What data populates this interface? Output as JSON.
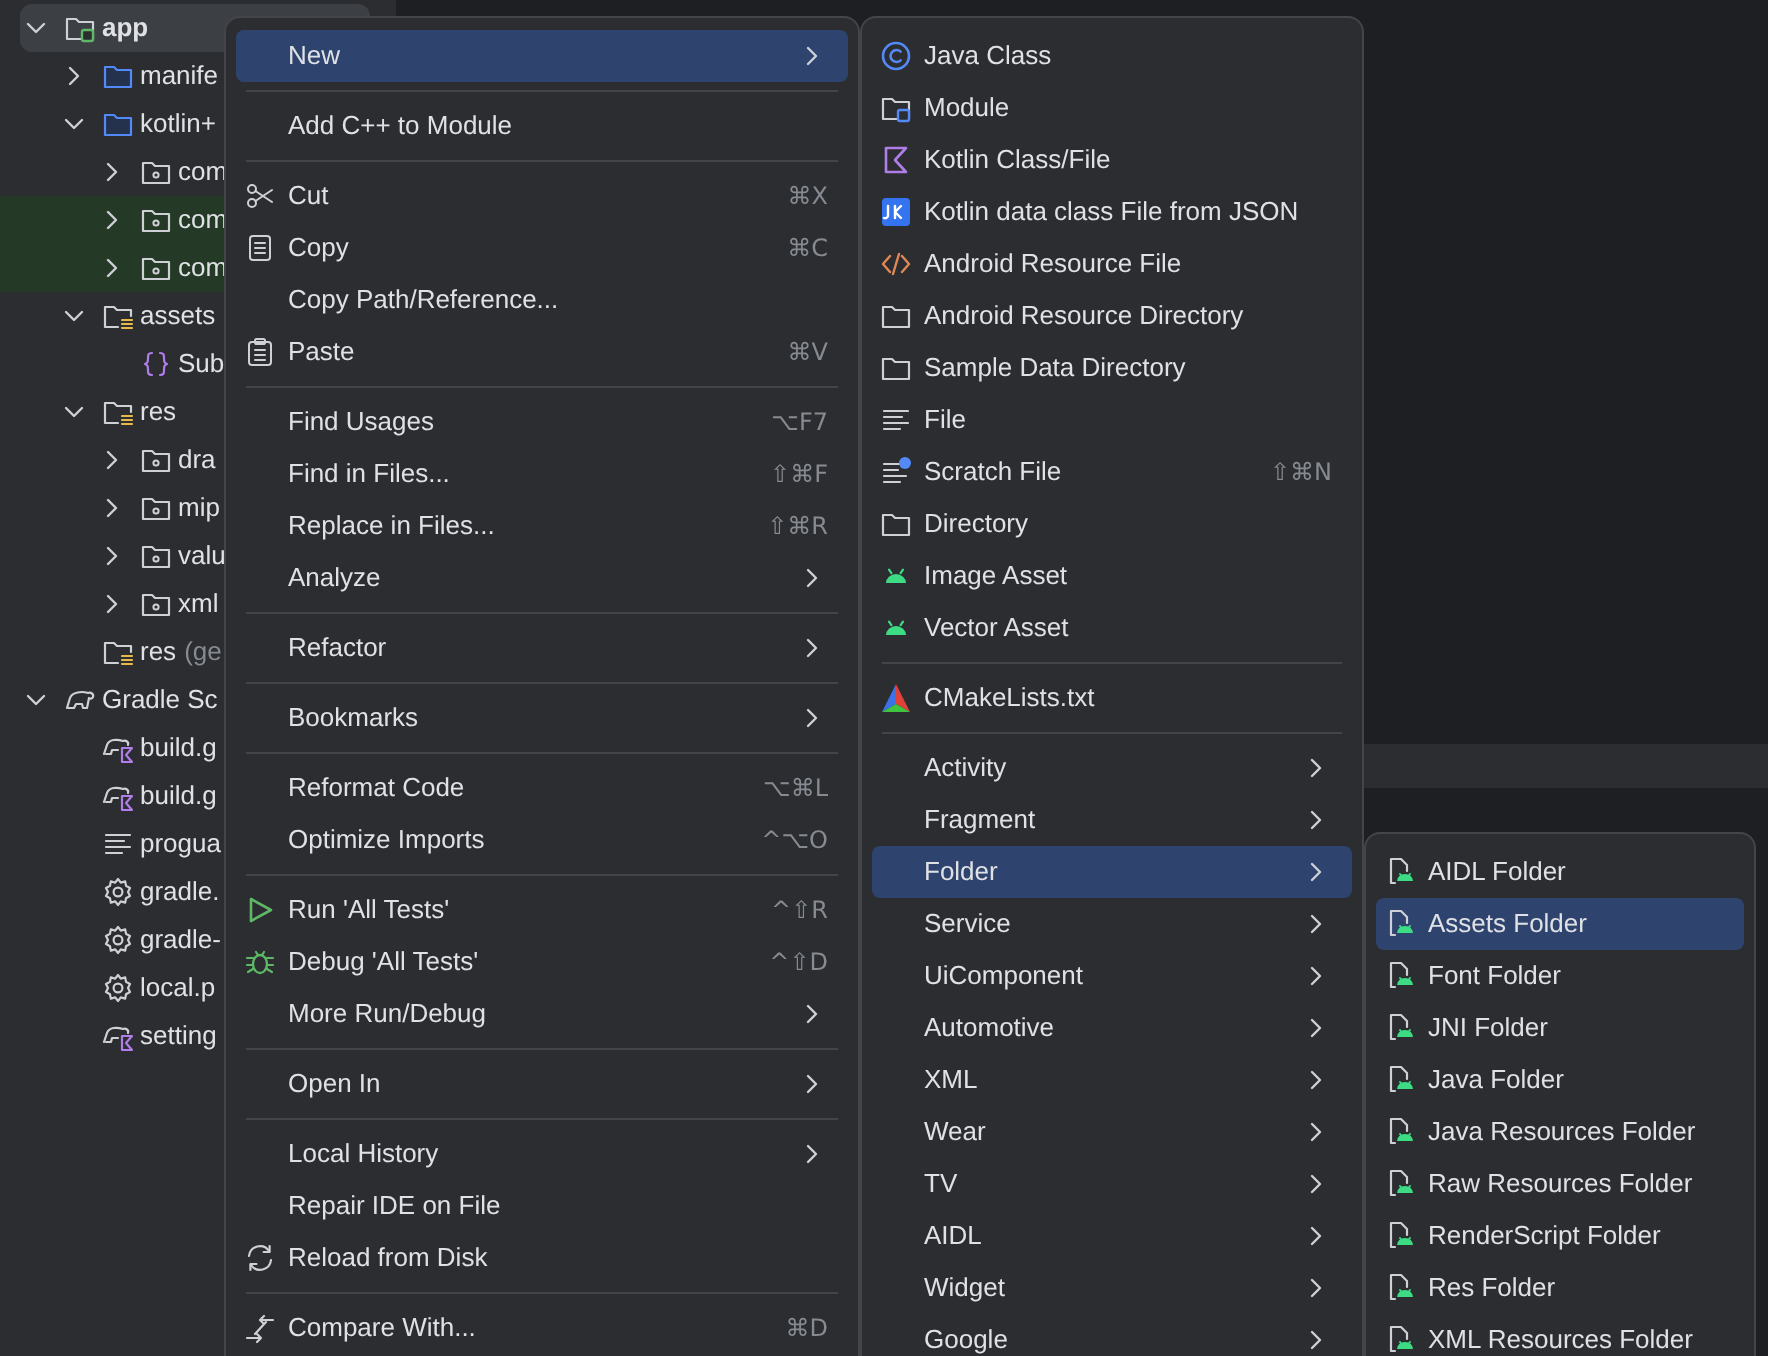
{
  "project_tree": [
    {
      "label": "app",
      "kind": "module",
      "expanded": true,
      "selected": true,
      "highlighted": false,
      "children": [
        {
          "label": "manife",
          "kind": "source-folder",
          "expanded": false,
          "selected": false,
          "highlighted": false
        },
        {
          "label": "kotlin+",
          "kind": "source-folder",
          "expanded": true,
          "selected": false,
          "highlighted": false,
          "children": [
            {
              "label": "com",
              "kind": "package",
              "expanded": false,
              "selected": false,
              "highlighted": false
            },
            {
              "label": "com",
              "kind": "package",
              "expanded": false,
              "selected": false,
              "highlighted": true
            },
            {
              "label": "com",
              "kind": "package",
              "expanded": false,
              "selected": false,
              "highlighted": true
            }
          ]
        },
        {
          "label": "assets",
          "kind": "resource-folder",
          "expanded": true,
          "selected": false,
          "highlighted": false,
          "children": [
            {
              "label": "Sub",
              "kind": "json-file",
              "selected": false,
              "highlighted": false
            }
          ]
        },
        {
          "label": "res",
          "kind": "resource-folder",
          "expanded": true,
          "selected": false,
          "highlighted": false,
          "children": [
            {
              "label": "dra",
              "kind": "package",
              "expanded": false,
              "selected": false,
              "highlighted": false
            },
            {
              "label": "mip",
              "kind": "package",
              "expanded": false,
              "selected": false,
              "highlighted": false
            },
            {
              "label": "valu",
              "kind": "package",
              "expanded": false,
              "selected": false,
              "highlighted": false
            },
            {
              "label": "xml",
              "kind": "package",
              "expanded": false,
              "selected": false,
              "highlighted": false
            }
          ]
        },
        {
          "label": "res",
          "note": "(ge",
          "kind": "resource-folder",
          "selected": false,
          "highlighted": false
        }
      ]
    },
    {
      "label": "Gradle Sc",
      "kind": "gradle-scripts",
      "expanded": true,
      "selected": false,
      "highlighted": false,
      "children": [
        {
          "label": "build.g",
          "kind": "gradle-file",
          "selected": false,
          "highlighted": false
        },
        {
          "label": "build.g",
          "kind": "gradle-file",
          "selected": false,
          "highlighted": false
        },
        {
          "label": "progua",
          "kind": "text-file",
          "selected": false,
          "highlighted": false
        },
        {
          "label": "gradle.",
          "kind": "settings-file",
          "selected": false,
          "highlighted": false
        },
        {
          "label": "gradle-",
          "kind": "settings-file",
          "selected": false,
          "highlighted": false
        },
        {
          "label": "local.p",
          "kind": "settings-file",
          "selected": false,
          "highlighted": false
        },
        {
          "label": "setting",
          "kind": "gradle-file",
          "selected": false,
          "highlighted": false
        }
      ]
    }
  ],
  "context_menu": {
    "items": [
      {
        "kind": "submenu",
        "label": "New",
        "selected": true
      },
      {
        "kind": "separator"
      },
      {
        "kind": "item",
        "label": "Add C++ to Module",
        "selected": false
      },
      {
        "kind": "separator"
      },
      {
        "kind": "item",
        "label": "Cut",
        "shortcut": "⌘X",
        "selected": false
      },
      {
        "kind": "item",
        "label": "Copy",
        "shortcut": "⌘C",
        "selected": false
      },
      {
        "kind": "item",
        "label": "Copy Path/Reference...",
        "selected": false
      },
      {
        "kind": "item",
        "label": "Paste",
        "shortcut": "⌘V",
        "selected": false
      },
      {
        "kind": "separator"
      },
      {
        "kind": "item",
        "label": "Find Usages",
        "shortcut": "⌥F7",
        "selected": false
      },
      {
        "kind": "item",
        "label": "Find in Files...",
        "shortcut": "⇧⌘F",
        "selected": false
      },
      {
        "kind": "item",
        "label": "Replace in Files...",
        "shortcut": "⇧⌘R",
        "selected": false
      },
      {
        "kind": "submenu",
        "label": "Analyze",
        "selected": false
      },
      {
        "kind": "separator"
      },
      {
        "kind": "submenu",
        "label": "Refactor",
        "selected": false
      },
      {
        "kind": "separator"
      },
      {
        "kind": "submenu",
        "label": "Bookmarks",
        "selected": false
      },
      {
        "kind": "separator"
      },
      {
        "kind": "item",
        "label": "Reformat Code",
        "shortcut": "⌥⌘L",
        "selected": false
      },
      {
        "kind": "item",
        "label": "Optimize Imports",
        "shortcut": "^⌥O",
        "selected": false
      },
      {
        "kind": "separator"
      },
      {
        "kind": "item",
        "label": "Run 'All Tests'",
        "shortcut": "^⇧R",
        "selected": false
      },
      {
        "kind": "item",
        "label": "Debug 'All Tests'",
        "shortcut": "^⇧D",
        "selected": false
      },
      {
        "kind": "submenu",
        "label": "More Run/Debug",
        "selected": false
      },
      {
        "kind": "separator"
      },
      {
        "kind": "submenu",
        "label": "Open In",
        "selected": false
      },
      {
        "kind": "separator"
      },
      {
        "kind": "submenu",
        "label": "Local History",
        "selected": false
      },
      {
        "kind": "item",
        "label": "Repair IDE on File",
        "selected": false
      },
      {
        "kind": "item",
        "label": "Reload from Disk",
        "selected": false
      },
      {
        "kind": "separator"
      },
      {
        "kind": "item",
        "label": "Compare With...",
        "shortcut": "⌘D",
        "selected": false
      }
    ]
  },
  "new_submenu": {
    "items": [
      {
        "kind": "item",
        "label": "Java Class",
        "selected": false
      },
      {
        "kind": "item",
        "label": "Module",
        "selected": false
      },
      {
        "kind": "item",
        "label": "Kotlin Class/File",
        "selected": false
      },
      {
        "kind": "item",
        "label": "Kotlin data class File from JSON",
        "selected": false
      },
      {
        "kind": "item",
        "label": "Android Resource File",
        "selected": false
      },
      {
        "kind": "item",
        "label": "Android Resource Directory",
        "selected": false
      },
      {
        "kind": "item",
        "label": "Sample Data Directory",
        "selected": false
      },
      {
        "kind": "item",
        "label": "File",
        "selected": false
      },
      {
        "kind": "item",
        "label": "Scratch File",
        "shortcut": "⇧⌘N",
        "selected": false
      },
      {
        "kind": "item",
        "label": "Directory",
        "selected": false
      },
      {
        "kind": "item",
        "label": "Image Asset",
        "selected": false
      },
      {
        "kind": "item",
        "label": "Vector Asset",
        "selected": false
      },
      {
        "kind": "separator"
      },
      {
        "kind": "item",
        "label": "CMakeLists.txt",
        "selected": false
      },
      {
        "kind": "separator"
      },
      {
        "kind": "submenu",
        "label": "Activity",
        "selected": false
      },
      {
        "kind": "submenu",
        "label": "Fragment",
        "selected": false
      },
      {
        "kind": "submenu",
        "label": "Folder",
        "selected": true
      },
      {
        "kind": "submenu",
        "label": "Service",
        "selected": false
      },
      {
        "kind": "submenu",
        "label": "UiComponent",
        "selected": false
      },
      {
        "kind": "submenu",
        "label": "Automotive",
        "selected": false
      },
      {
        "kind": "submenu",
        "label": "XML",
        "selected": false
      },
      {
        "kind": "submenu",
        "label": "Wear",
        "selected": false
      },
      {
        "kind": "submenu",
        "label": "TV",
        "selected": false
      },
      {
        "kind": "submenu",
        "label": "AIDL",
        "selected": false
      },
      {
        "kind": "submenu",
        "label": "Widget",
        "selected": false
      },
      {
        "kind": "submenu",
        "label": "Google",
        "selected": false
      }
    ]
  },
  "folder_submenu": {
    "items": [
      {
        "kind": "item",
        "label": "AIDL Folder",
        "selected": false
      },
      {
        "kind": "item",
        "label": "Assets Folder",
        "selected": true
      },
      {
        "kind": "item",
        "label": "Font Folder",
        "selected": false
      },
      {
        "kind": "item",
        "label": "JNI Folder",
        "selected": false
      },
      {
        "kind": "item",
        "label": "Java Folder",
        "selected": false
      },
      {
        "kind": "item",
        "label": "Java Resources Folder",
        "selected": false
      },
      {
        "kind": "item",
        "label": "Raw Resources Folder",
        "selected": false
      },
      {
        "kind": "item",
        "label": "RenderScript Folder",
        "selected": false
      },
      {
        "kind": "item",
        "label": "Res Folder",
        "selected": false
      },
      {
        "kind": "item",
        "label": "XML Resources Folder",
        "selected": false
      }
    ]
  }
}
